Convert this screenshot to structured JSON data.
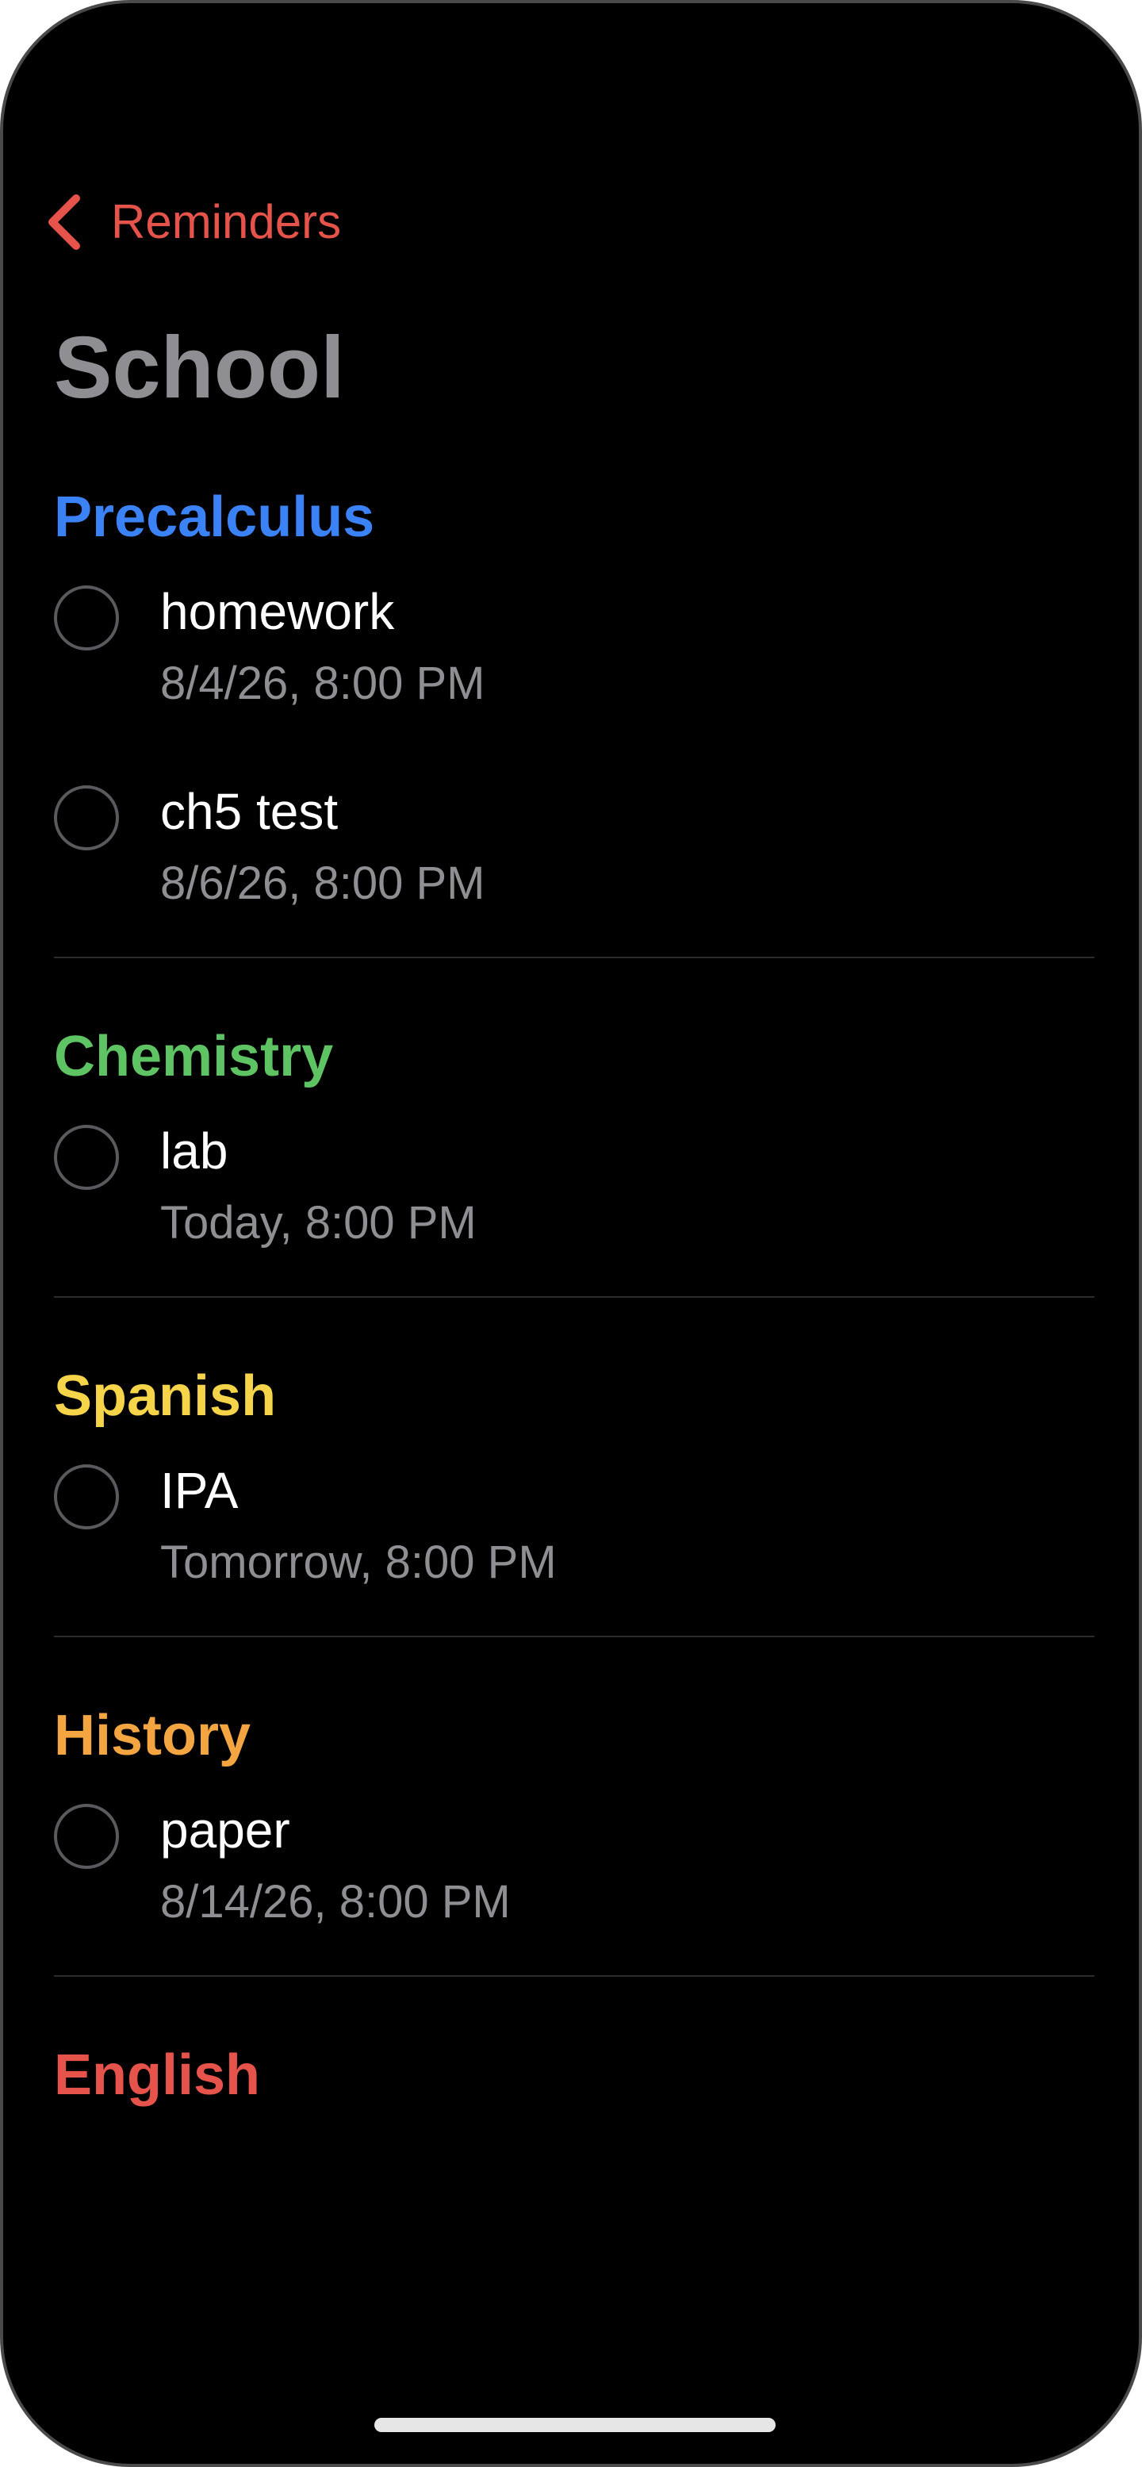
{
  "nav": {
    "back_label": "Reminders"
  },
  "page": {
    "title": "School"
  },
  "sections": [
    {
      "title": "Precalculus",
      "color": "#3b82f6",
      "items": [
        {
          "title": "homework",
          "date": "8/4/26, 8:00 PM"
        },
        {
          "title": "ch5 test",
          "date": "8/6/26, 8:00 PM"
        }
      ]
    },
    {
      "title": "Chemistry",
      "color": "#5ec463",
      "items": [
        {
          "title": "lab",
          "date": "Today, 8:00 PM"
        }
      ]
    },
    {
      "title": "Spanish",
      "color": "#f5d44a",
      "items": [
        {
          "title": "IPA",
          "date": "Tomorrow, 8:00 PM"
        }
      ]
    },
    {
      "title": "History",
      "color": "#f2a541",
      "items": [
        {
          "title": "paper",
          "date": "8/14/26, 8:00 PM"
        }
      ]
    },
    {
      "title": "English",
      "color": "#e5534b",
      "items": []
    }
  ],
  "colors": {
    "accent": "#e5534b",
    "background": "#000000",
    "secondary_text": "#8e8e93",
    "home_indicator": "#e6e6e6"
  },
  "icons": {
    "back": "chevron-left-icon",
    "checkbox": "empty-circle-icon"
  }
}
